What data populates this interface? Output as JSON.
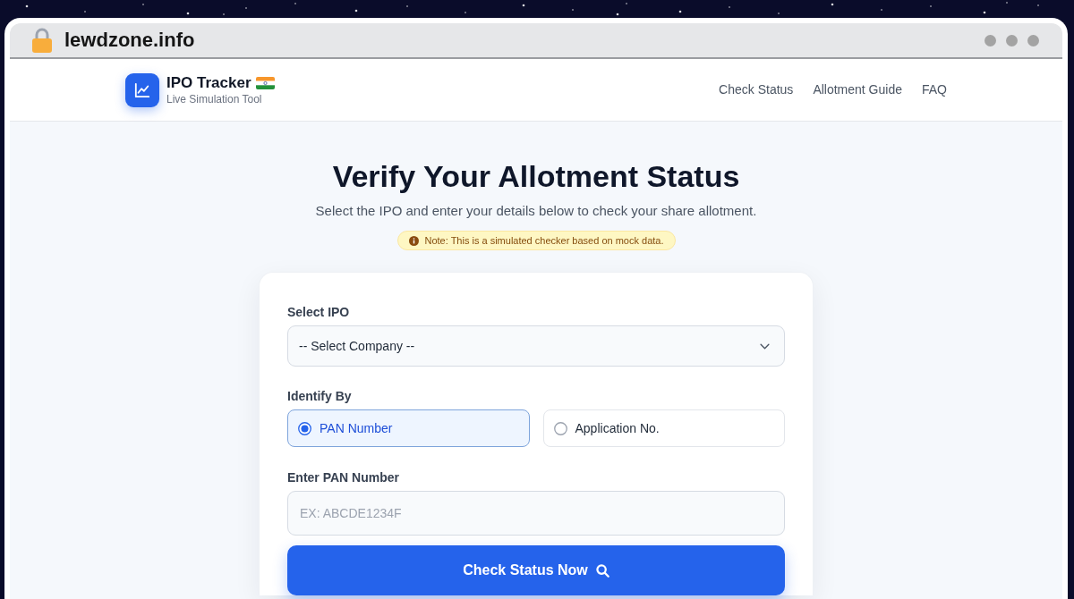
{
  "browser": {
    "url": "lewdzone.info"
  },
  "header": {
    "brand": {
      "name": "IPO Tracker",
      "tagline": "Live Simulation Tool"
    },
    "nav": [
      {
        "label": "Check Status"
      },
      {
        "label": "Allotment Guide"
      },
      {
        "label": "FAQ"
      }
    ]
  },
  "hero": {
    "title": "Verify Your Allotment Status",
    "subtitle": "Select the IPO and enter your details below to check your share allotment.",
    "note": "Note: This is a simulated checker based on mock data."
  },
  "form": {
    "ipo_label": "Select IPO",
    "ipo_select": {
      "value": "-- Select Company --"
    },
    "identify_label": "Identify By",
    "options": [
      {
        "label": "PAN Number",
        "selected": true
      },
      {
        "label": "Application No.",
        "selected": false
      }
    ],
    "input_label": "Enter PAN Number",
    "input": {
      "placeholder": "EX: ABCDE1234F"
    },
    "submit": "Check Status Now"
  }
}
